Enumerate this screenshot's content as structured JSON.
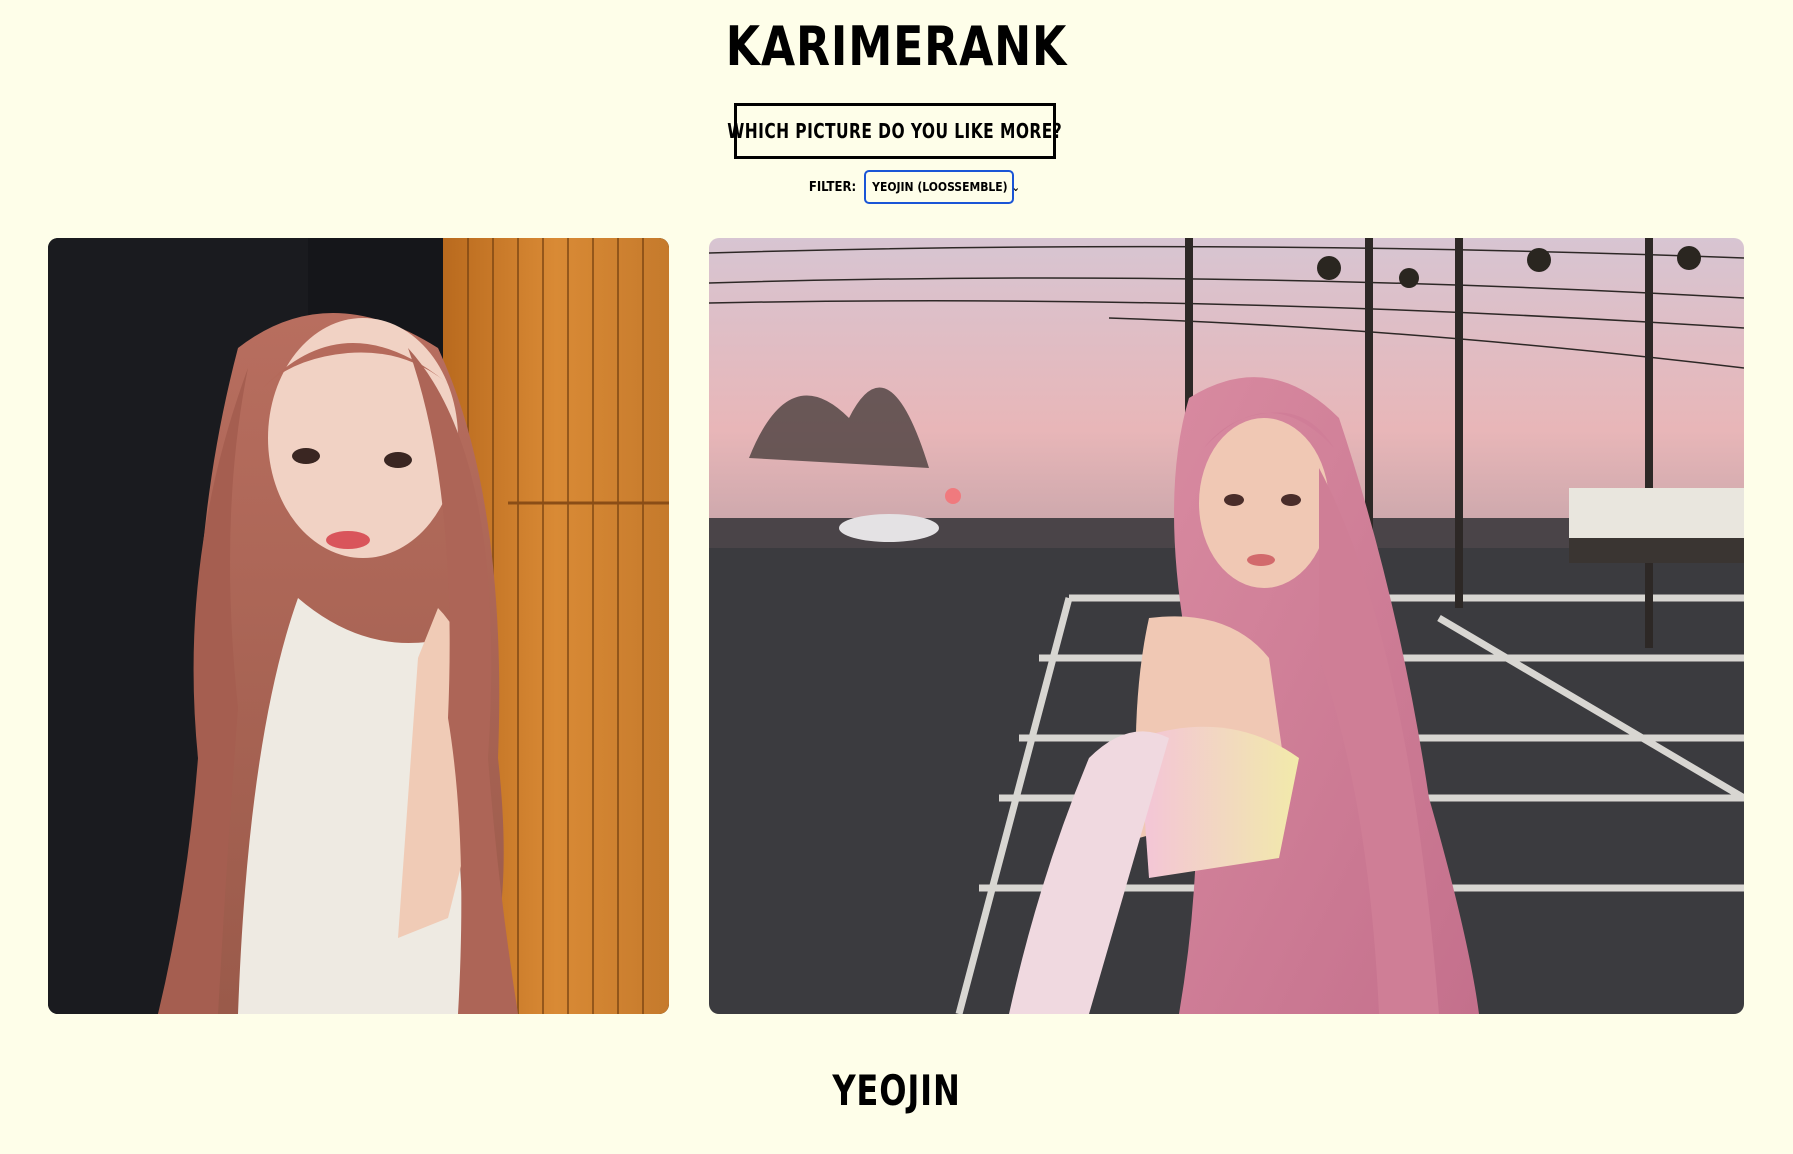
{
  "site": {
    "title": "KARIMERANK"
  },
  "prompt": {
    "question": "WHICH PICTURE DO YOU LIKE MORE?"
  },
  "filter": {
    "label": "FILTER:",
    "selected": "YEOJIN (LOOSSEMBLE)"
  },
  "photos": {
    "left": {
      "alt": "photo-option-left"
    },
    "right": {
      "alt": "photo-option-right"
    }
  },
  "member": {
    "name": "YEOJIN"
  },
  "colors": {
    "background": "#fefee9",
    "select_border": "#1a55d6"
  },
  "icons": {
    "select": "chevron-down-icon"
  }
}
